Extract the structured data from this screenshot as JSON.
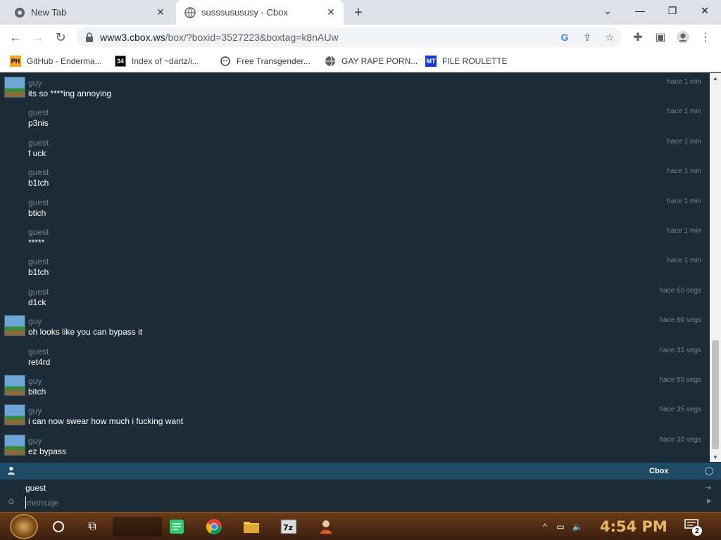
{
  "browser": {
    "tabs": [
      {
        "title": "New Tab",
        "close": "✕"
      },
      {
        "title": "susssusususy - Cbox",
        "close": "✕"
      }
    ],
    "new_tab": "+",
    "url_host": "www3.cbox.ws",
    "url_path": "/box/?boxid=3527223&boxtag=k8nAUw",
    "bookmarks": [
      {
        "label": "GitHub - Enderma...",
        "icon": "PH"
      },
      {
        "label": "Index of ~dartz/i...",
        "icon": "34"
      },
      {
        "label": "Free Transgender...",
        "icon": ""
      },
      {
        "label": "GAY RAPE PORN...",
        "icon": ""
      },
      {
        "label": "FILE ROULETTE",
        "icon": "MT"
      }
    ]
  },
  "chat": {
    "messages": [
      {
        "name": "guy",
        "text": "its so ****ing annoying",
        "time": "hace 1 min",
        "avatar": true
      },
      {
        "name": "guest",
        "text": "p3nis",
        "time": "hace 1 min",
        "avatar": false
      },
      {
        "name": "guest",
        "text": "f uck",
        "time": "hace 1 min",
        "avatar": false
      },
      {
        "name": "guest",
        "text": "b1tch",
        "time": "hace 1 min",
        "avatar": false
      },
      {
        "name": "guest",
        "text": "btich",
        "time": "hace 1 min",
        "avatar": false
      },
      {
        "name": "guest",
        "text": "*****",
        "time": "hace 1 min",
        "avatar": false
      },
      {
        "name": "guest",
        "text": "b1tch",
        "time": "hace 1 min",
        "avatar": false
      },
      {
        "name": "guest",
        "text": "d1ck",
        "time": "hace 60 segs",
        "avatar": false
      },
      {
        "name": "guy",
        "text": "oh looks like you can bypass it",
        "time": "hace 60 segs",
        "avatar": true
      },
      {
        "name": "guest",
        "text": "ret4rd",
        "time": "hace 35 segs",
        "avatar": false
      },
      {
        "name": "guy",
        "text": "bitch",
        "time": "hace 50 segs",
        "avatar": true
      },
      {
        "name": "guy",
        "text": "i can now swear how much i fucking want",
        "time": "hace 35 segs",
        "avatar": true
      },
      {
        "name": "guy",
        "text": "ez bypass",
        "time": "hace 30 segs",
        "avatar": true
      }
    ],
    "brand": "Cbox",
    "current_user": "guest",
    "message_placeholder": "mensaje"
  },
  "taskbar": {
    "clock": "4:54 PM",
    "notification_count": "2"
  },
  "colors": {
    "chat_bg": "#1c2b35",
    "chat_bar": "#1f4a66",
    "clock": "#e8b860"
  }
}
